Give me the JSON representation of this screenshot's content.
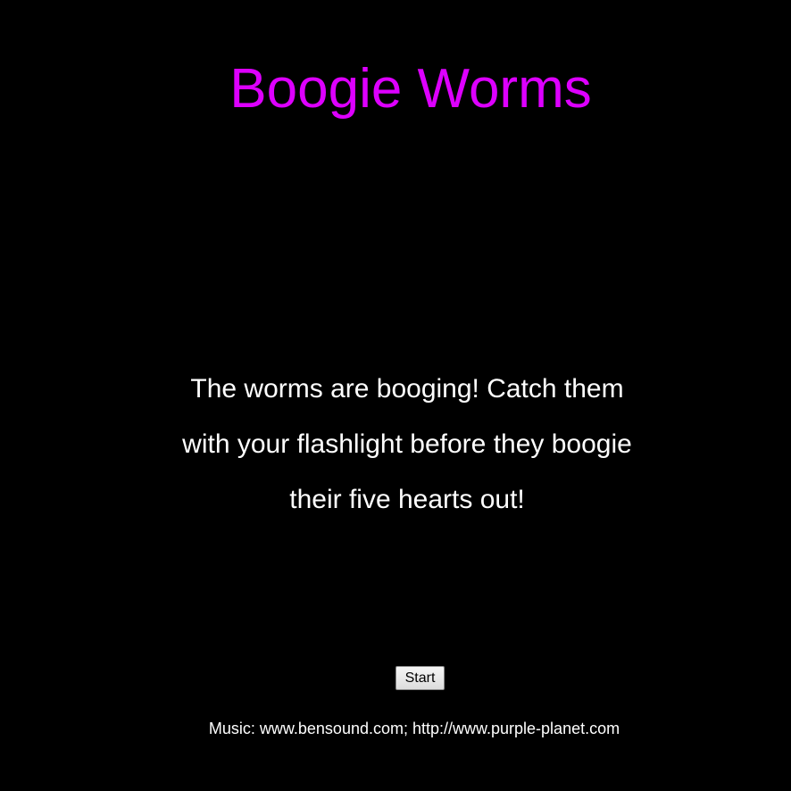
{
  "game": {
    "title": "Boogie Worms",
    "instructions": [
      "The worms are booging! Catch them",
      "with your flashlight before they boogie",
      "their five hearts out!"
    ],
    "start_label": "Start",
    "credits": "Music: www.bensound.com; http://www.purple-planet.com"
  },
  "colors": {
    "background": "#000000",
    "title": "#dd00ff",
    "text": "#ffffff"
  }
}
